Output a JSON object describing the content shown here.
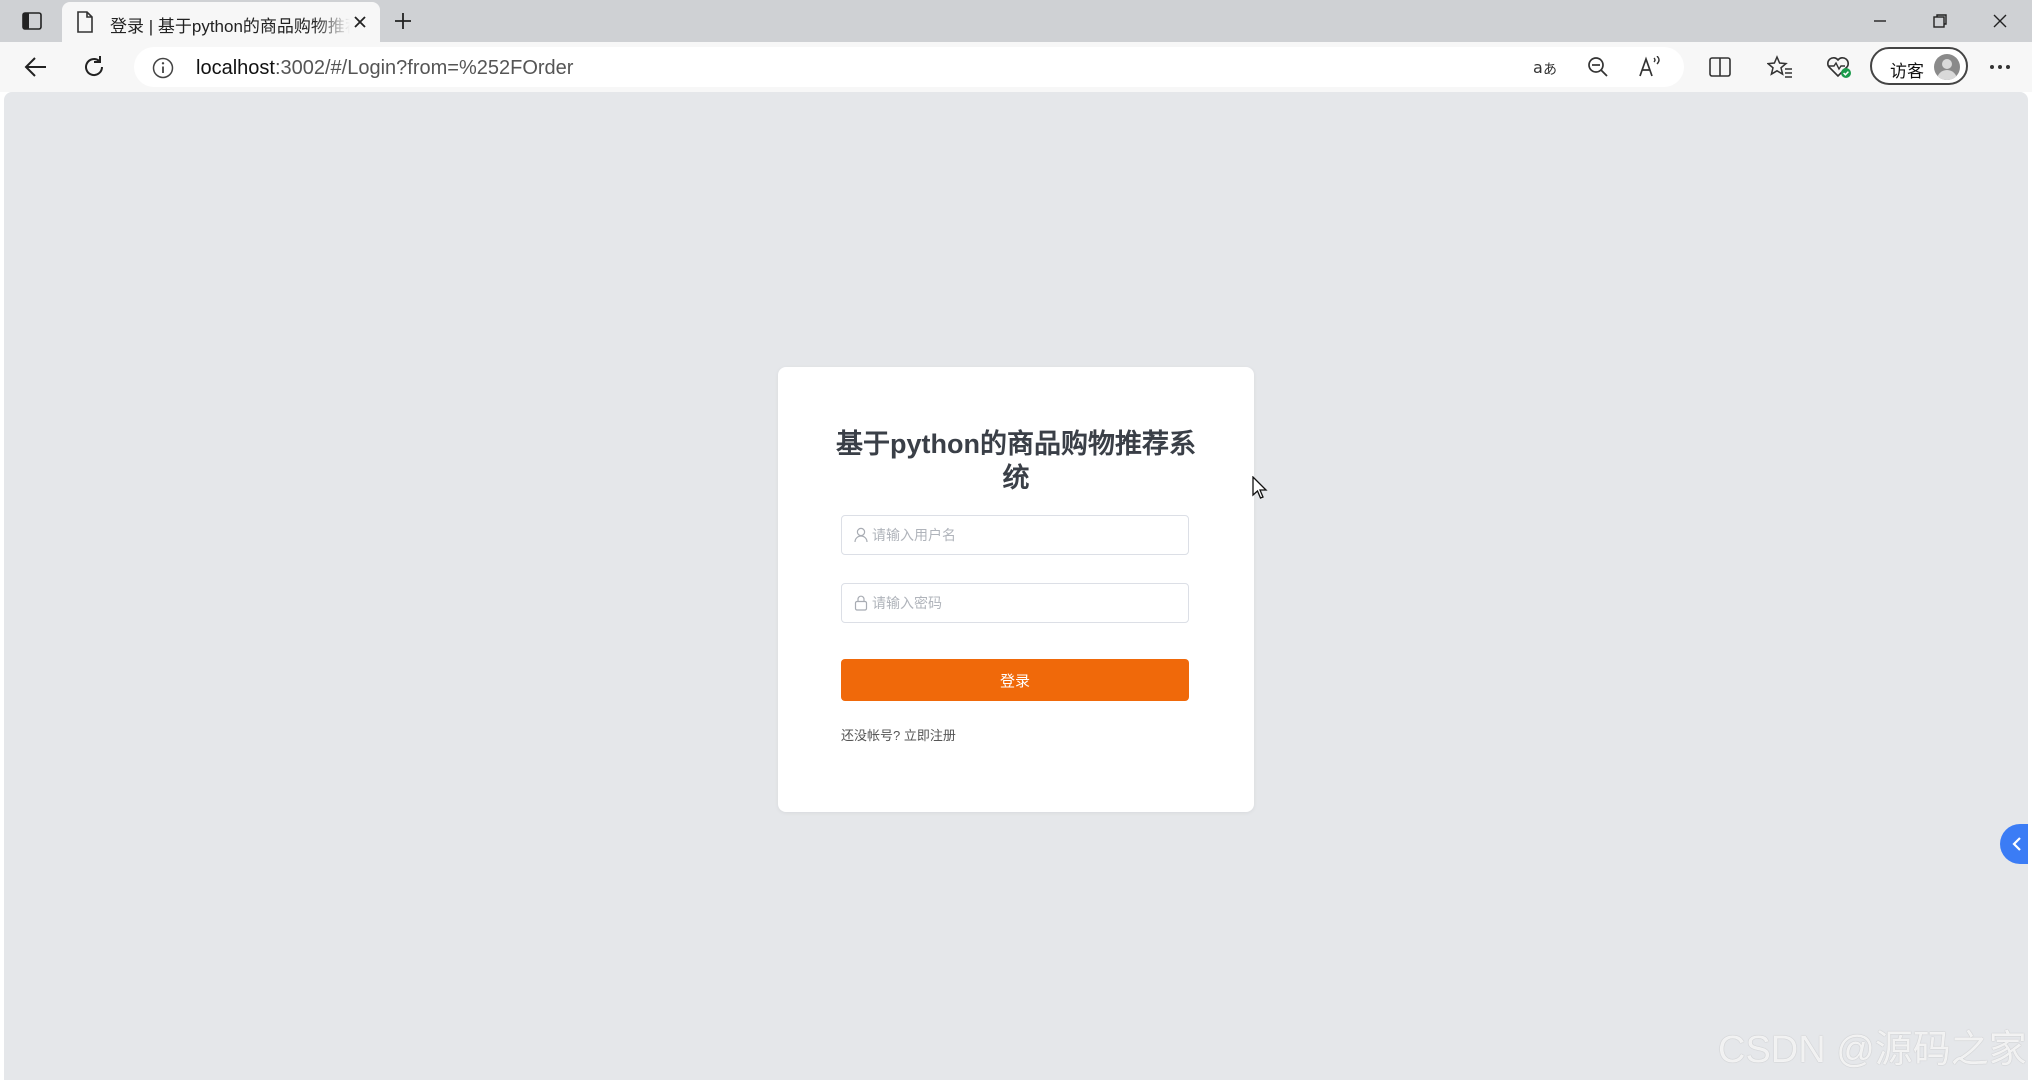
{
  "browser": {
    "tab": {
      "title": "登录 | 基于python的商品购物推荐系统"
    },
    "address_bar": {
      "url_host": "localhost",
      "url_rest": ":3002/#/Login?from=%252FOrder"
    },
    "profile": {
      "label": "访客"
    },
    "icons": {
      "tab_actions": "tab-actions-icon",
      "page": "page-icon",
      "close": "close-icon",
      "new_tab": "plus-icon",
      "minimize": "minimize-icon",
      "restore": "restore-icon",
      "close_window": "close-icon",
      "back": "back-arrow-icon",
      "refresh": "refresh-icon",
      "site_info": "info-icon",
      "translate": "translate-icon",
      "zoom_out": "zoom-out-icon",
      "read_aloud": "read-aloud-icon",
      "split_screen": "split-screen-icon",
      "favorites": "favorites-icon",
      "browser_essentials": "heart-pulse-icon",
      "more": "more-icon"
    }
  },
  "login": {
    "title": "基于python的商品购物推荐系统",
    "username_placeholder": "请输入用户名",
    "password_placeholder": "请输入密码",
    "submit_label": "登录",
    "register_prompt": "还没帐号? ",
    "register_link": "立即注册"
  },
  "watermark": "CSDN @源码之家",
  "colors": {
    "accent": "#f0690a",
    "page_background": "#e5e7ea",
    "side_toggle": "#3b7cf5"
  }
}
